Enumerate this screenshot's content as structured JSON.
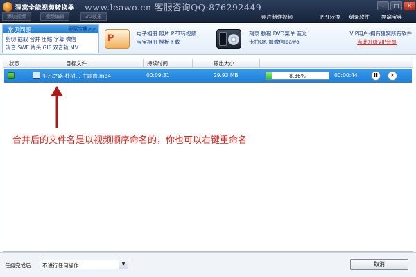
{
  "window": {
    "title": "狸窝全能视频转换器",
    "watermark": "www.leawo.cn 客服咨询QQ:876292449",
    "buttons": {
      "minimize": "–",
      "maximize": "□",
      "close": "✕"
    },
    "top_buttons": [
      "添加视频",
      "视频编辑",
      "3D效果"
    ],
    "menu": [
      "照片制作视频",
      "PPT转换",
      "刻录软件",
      "狸窝宝典"
    ]
  },
  "faq": {
    "title": "常见问题",
    "more": "狸窝宝典>>",
    "line1": "剪切 截取 合并 压缩 字幕 微信",
    "line2": "消音 SWF 片头 GIF 双音轨 MV"
  },
  "promo1": {
    "icon": "ppt-icon",
    "icon_letter": "P",
    "line1": "电子相册 照片 PPT转视频",
    "line2": "宝宝相册 模板下载"
  },
  "promo2": {
    "icon": "dvd-icon",
    "line1": "刻录 教程 DVD菜单 蓝光",
    "line2": "卡拉OK 加微信leawo"
  },
  "vip": {
    "line1": "VIP用户-拥有狸窝所有软件",
    "link": "点此升级VIP会员",
    "link_color": "#e8231a"
  },
  "table": {
    "headers": [
      "状态",
      "目标文件",
      "持续时间",
      "输出大小"
    ],
    "rows": [
      {
        "status_icon": "check-icon",
        "file": "平凡之路-朴树... 主题曲.mp4",
        "duration": "00:09:31",
        "size": "29.93 MB",
        "progress_text": "8.36%",
        "progress": 0.0836,
        "remaining": "00:00:44",
        "pause_label": "II",
        "remove_label": "✕"
      }
    ]
  },
  "annotation": "合并后的文件名是以视频顺序命名的，你也可以右键重命名",
  "colors": {
    "accent": "#1f7ed8",
    "annotation": "#e8231a",
    "progress": "#2fc32a"
  },
  "bottom": {
    "after_label": "任务完成后:",
    "after_value": "不进行任何操作",
    "dropdown_arrow": "▼",
    "cancel": "取消"
  }
}
